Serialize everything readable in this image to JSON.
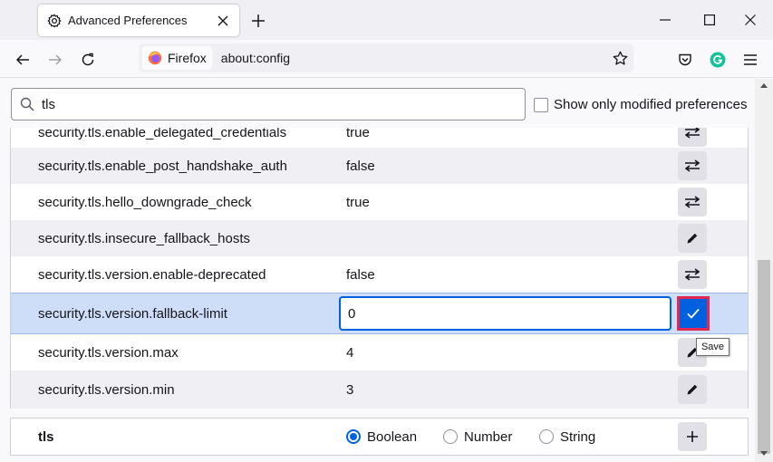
{
  "browser": {
    "tab_title": "Advanced Preferences",
    "identity_label": "Firefox",
    "url": "about:config"
  },
  "search": {
    "value": "tls",
    "show_modified_label": "Show only modified preferences",
    "show_modified_checked": false
  },
  "preferences": [
    {
      "name": "security.tls.enable_delegated_credentials",
      "value": "true",
      "action": "toggle"
    },
    {
      "name": "security.tls.enable_post_handshake_auth",
      "value": "false",
      "action": "toggle"
    },
    {
      "name": "security.tls.hello_downgrade_check",
      "value": "true",
      "action": "toggle"
    },
    {
      "name": "security.tls.insecure_fallback_hosts",
      "value": "",
      "action": "edit"
    },
    {
      "name": "security.tls.version.enable-deprecated",
      "value": "false",
      "action": "toggle"
    },
    {
      "name": "security.tls.version.fallback-limit",
      "value": "0",
      "action": "save",
      "editing": true
    },
    {
      "name": "security.tls.version.max",
      "value": "4",
      "action": "edit"
    },
    {
      "name": "security.tls.version.min",
      "value": "3",
      "action": "edit"
    }
  ],
  "tooltip": "Save",
  "new_pref": {
    "name": "tls",
    "types": [
      "Boolean",
      "Number",
      "String"
    ],
    "selected_type": "Boolean"
  },
  "colors": {
    "accent": "#0061e0",
    "highlight_row": "#cfdef8",
    "save_outline": "#e22850",
    "grammarly": "#15c39a"
  }
}
